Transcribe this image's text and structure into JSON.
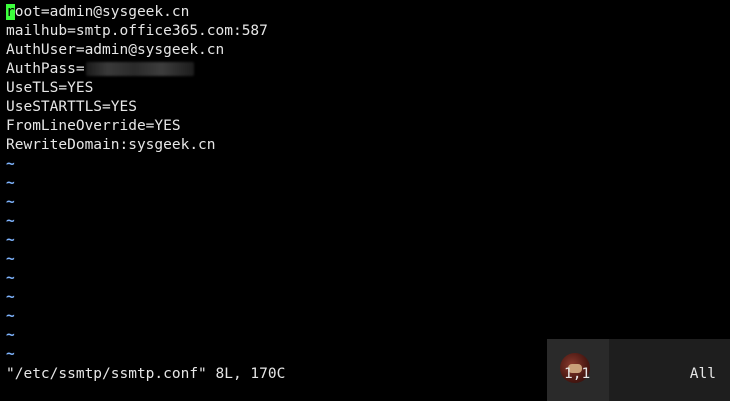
{
  "editor": {
    "lines": [
      {
        "text": "oot=admin@sysgeek.cn",
        "cursor_char": "r"
      },
      {
        "text": "mailhub=smtp.office365.com:587"
      },
      {
        "text": "AuthUser=admin@sysgeek.cn"
      },
      {
        "text": "AuthPass=",
        "redacted": true
      },
      {
        "text": "UseTLS=YES"
      },
      {
        "text": "UseSTARTTLS=YES"
      },
      {
        "text": "FromLineOverride=YES"
      },
      {
        "text": "RewriteDomain:sysgeek.cn"
      }
    ],
    "empty_line_marker": "~",
    "empty_line_count": 11
  },
  "status": {
    "message": "\"/etc/ssmtp/ssmtp.conf\" 8L, 170C",
    "cursor_position": "1,1",
    "scroll_position": "All"
  },
  "colors": {
    "background": "#000000",
    "text": "#e6e6e6",
    "cursor": "#3cff3c",
    "tilde": "#7fb4ff"
  },
  "icons": {
    "avatar": "user-avatar-icon"
  }
}
